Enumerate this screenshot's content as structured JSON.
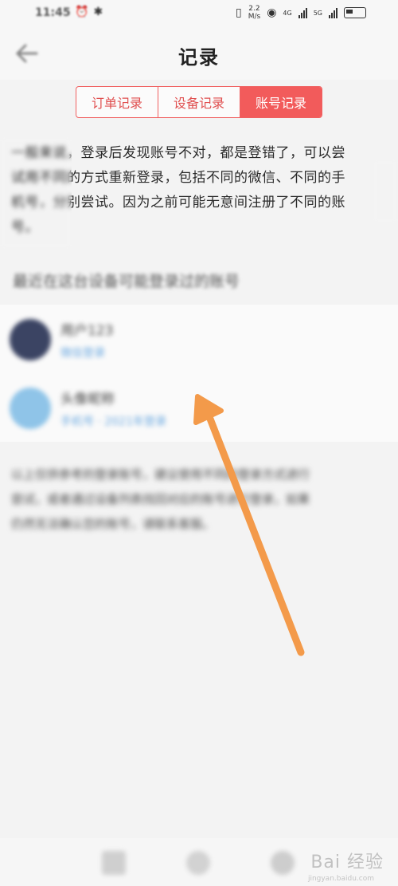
{
  "status_bar": {
    "time": "11:45",
    "net_speed_value": "2.2",
    "net_speed_unit": "M/s",
    "network_1": "4G",
    "network_2": "5G"
  },
  "header": {
    "title": "记录"
  },
  "tabs": [
    {
      "label": "订单记录",
      "active": false
    },
    {
      "label": "设备记录",
      "active": false
    },
    {
      "label": "账号记录",
      "active": true
    }
  ],
  "intro": {
    "lines": [
      "一般来说，登录后发现账号不对，都是登错了，可以尝",
      "试用不同的方式重新登录，包括不同的微信、不同的手",
      "机号，分别尝试。因为之前可能无意间注册了不同的账",
      "号。"
    ]
  },
  "section": {
    "heading": "最近在这台设备可能登录过的账号"
  },
  "accounts": [
    {
      "name": "用户123",
      "sub": "微信登录"
    },
    {
      "name": "头像昵称",
      "sub": "手机号 · 2021年登录"
    }
  ],
  "note": {
    "lines": [
      "以上仅供参考的登录账号，建议使用不同的登录方式进行",
      "尝试，或者通过设备列表找回对应的账号进行登录，如果",
      "仍然无法确认您的账号，请联系客服。"
    ]
  },
  "watermark": {
    "text": "Bai 经验",
    "sub": "jingyan.baidu.com"
  },
  "colors": {
    "accent": "#f25b5b",
    "arrow": "#f39a4a",
    "link": "#6aa8e0"
  }
}
